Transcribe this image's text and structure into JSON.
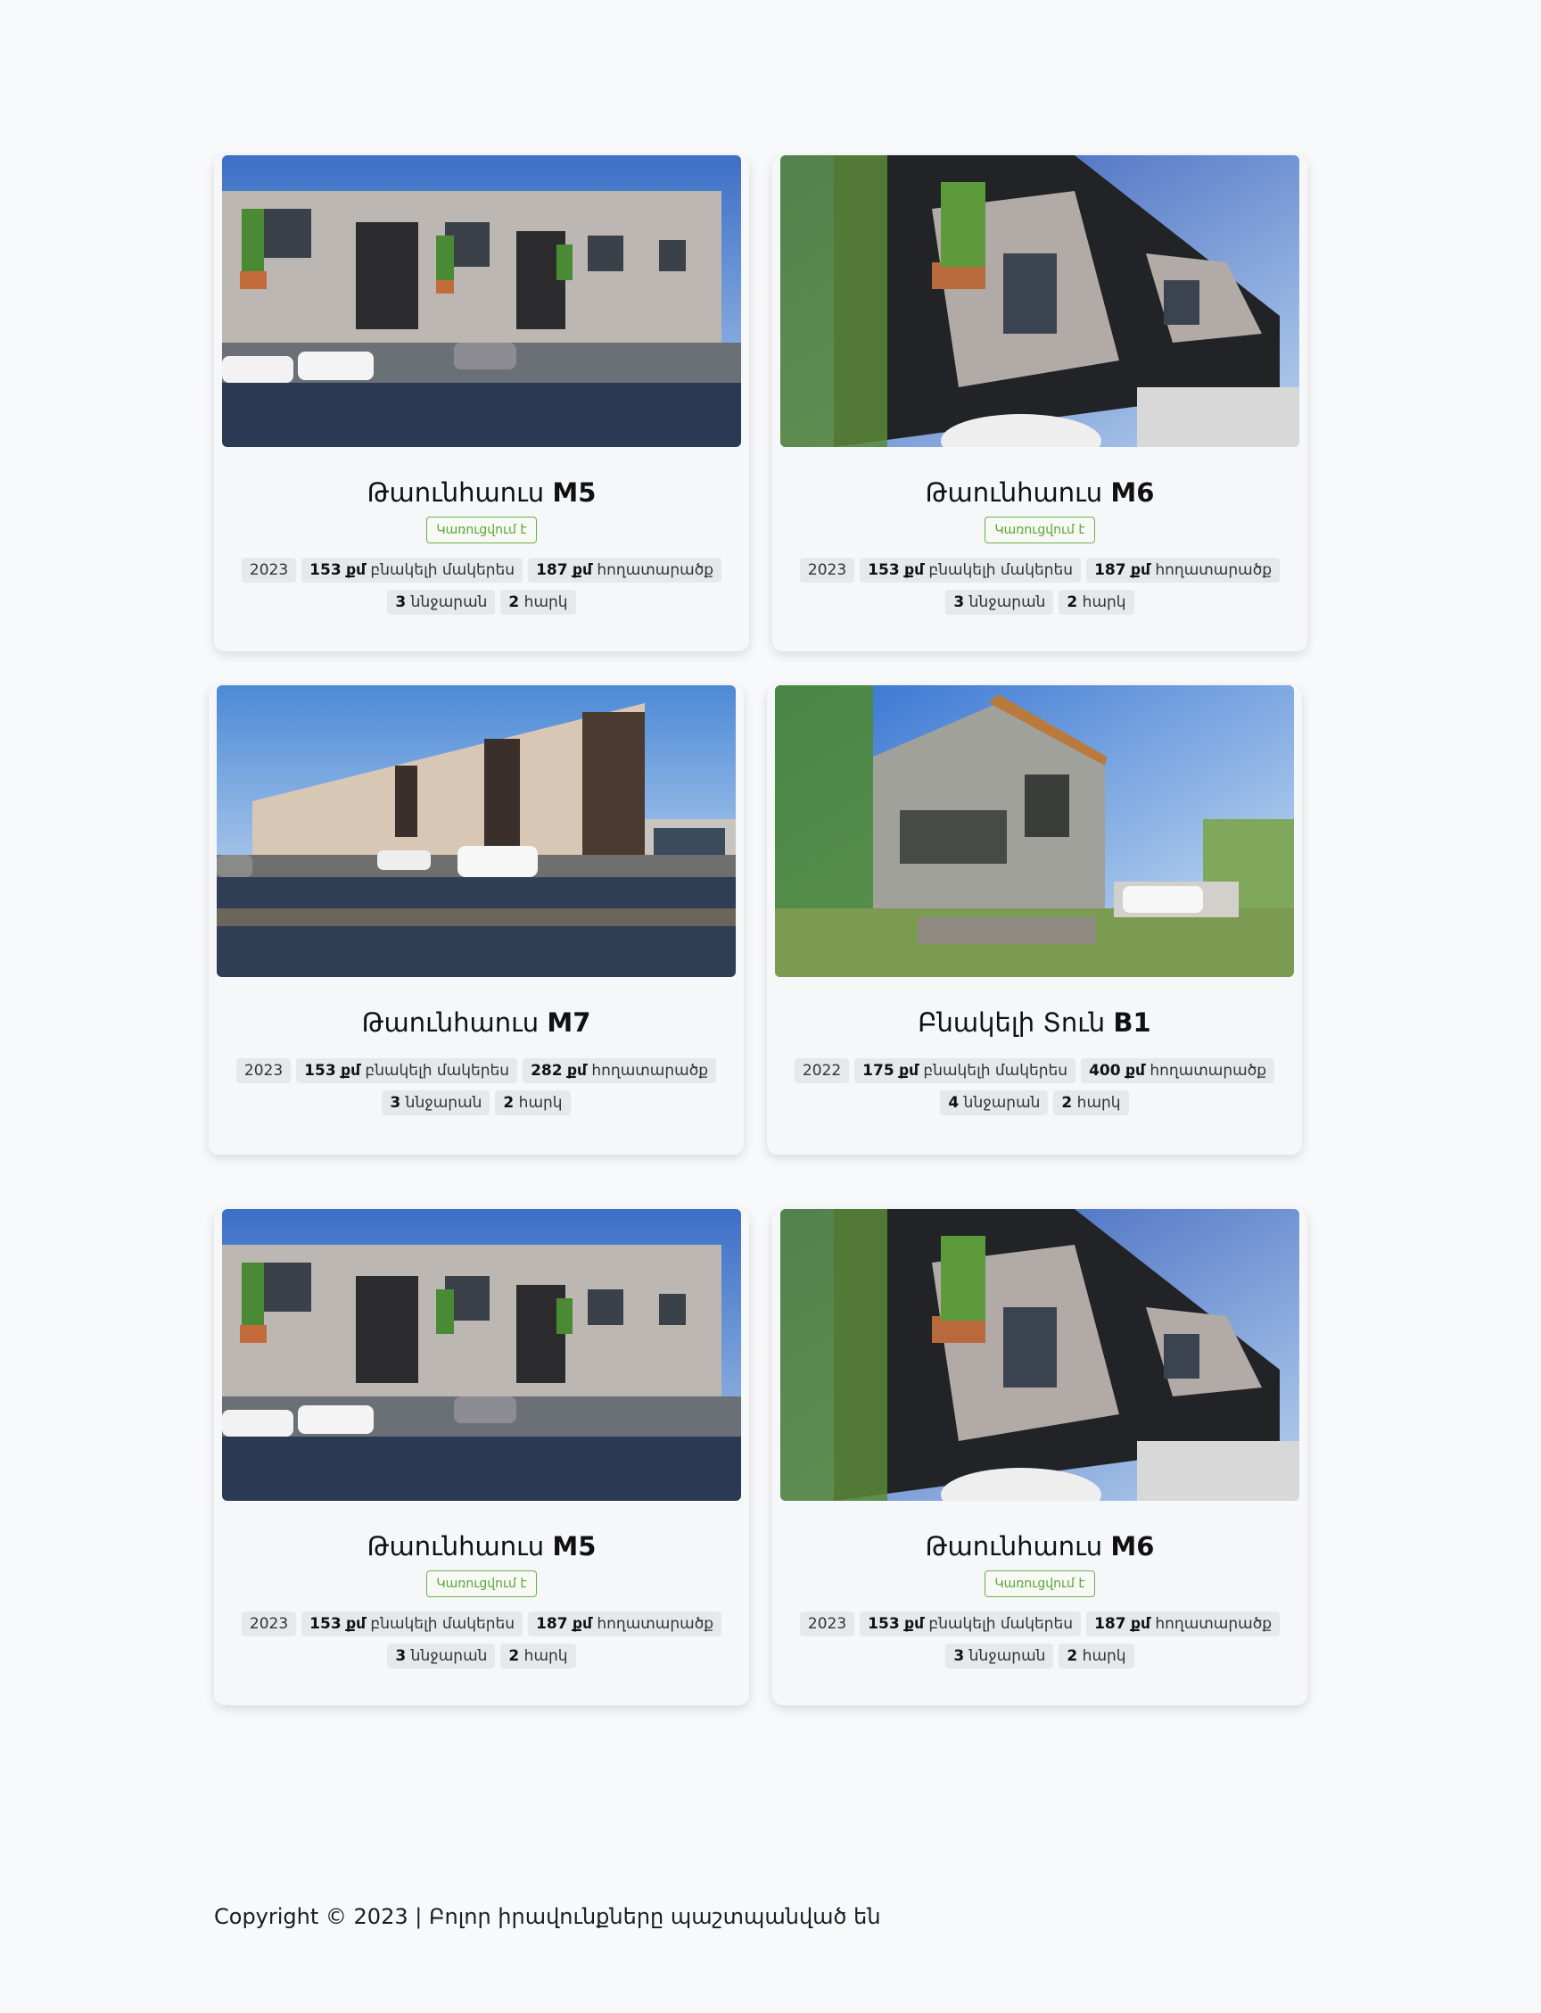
{
  "cards": [
    {
      "title_prefix": "Թաունհաուս",
      "title_code": "M5",
      "status": "Կառուցվում է",
      "year": "2023",
      "living_area": "153",
      "living_area_unit": "քմ",
      "living_area_label": "բնակելի մակերես",
      "land_area": "187",
      "land_area_unit": "քմ",
      "land_area_label": "հողատարածք",
      "bedrooms": "3",
      "bedrooms_label": "ննջարան",
      "floors": "2",
      "floors_label": "հարկ"
    },
    {
      "title_prefix": "Թաունհաուս",
      "title_code": "M6",
      "status": "Կառուցվում է",
      "year": "2023",
      "living_area": "153",
      "living_area_unit": "քմ",
      "living_area_label": "բնակելի մակերես",
      "land_area": "187",
      "land_area_unit": "քմ",
      "land_area_label": "հողատարածք",
      "bedrooms": "3",
      "bedrooms_label": "ննջարան",
      "floors": "2",
      "floors_label": "հարկ"
    },
    {
      "title_prefix": "Թաունհաուս",
      "title_code": "M7",
      "year": "2023",
      "living_area": "153",
      "living_area_unit": "քմ",
      "living_area_label": "բնակելի մակերես",
      "land_area": "282",
      "land_area_unit": "քմ",
      "land_area_label": "հողատարածք",
      "bedrooms": "3",
      "bedrooms_label": "ննջարան",
      "floors": "2",
      "floors_label": "հարկ"
    },
    {
      "title_prefix": "Բնակելի Տուն",
      "title_code": "B1",
      "year": "2022",
      "living_area": "175",
      "living_area_unit": "քմ",
      "living_area_label": "բնակելի մակերես",
      "land_area": "400",
      "land_area_unit": "քմ",
      "land_area_label": "հողատարածք",
      "bedrooms": "4",
      "bedrooms_label": "ննջարան",
      "floors": "2",
      "floors_label": "հարկ"
    },
    {
      "title_prefix": "Թաունհաուս",
      "title_code": "M5",
      "status": "Կառուցվում է",
      "year": "2023",
      "living_area": "153",
      "living_area_unit": "քմ",
      "living_area_label": "բնակելի մակերես",
      "land_area": "187",
      "land_area_unit": "քմ",
      "land_area_label": "հողատարածք",
      "bedrooms": "3",
      "bedrooms_label": "ննջարան",
      "floors": "2",
      "floors_label": "հարկ"
    },
    {
      "title_prefix": "Թաունհաուս",
      "title_code": "M6",
      "status": "Կառուցվում է",
      "year": "2023",
      "living_area": "153",
      "living_area_unit": "քմ",
      "living_area_label": "բնակելի մակերես",
      "land_area": "187",
      "land_area_unit": "քմ",
      "land_area_label": "հողատարածք",
      "bedrooms": "3",
      "bedrooms_label": "ննջարան",
      "floors": "2",
      "floors_label": "հարկ"
    }
  ],
  "footer": {
    "text": "Copyright © 2023 | Բոլոր իրավունքները պաշտպանված են"
  },
  "colors": {
    "badge_border": "#6db14b",
    "badge_text": "#5aa536",
    "page_bg": "#f8f9fb",
    "card_bg": "#f6f7f9",
    "tag_bg": "#e7e8ea"
  }
}
